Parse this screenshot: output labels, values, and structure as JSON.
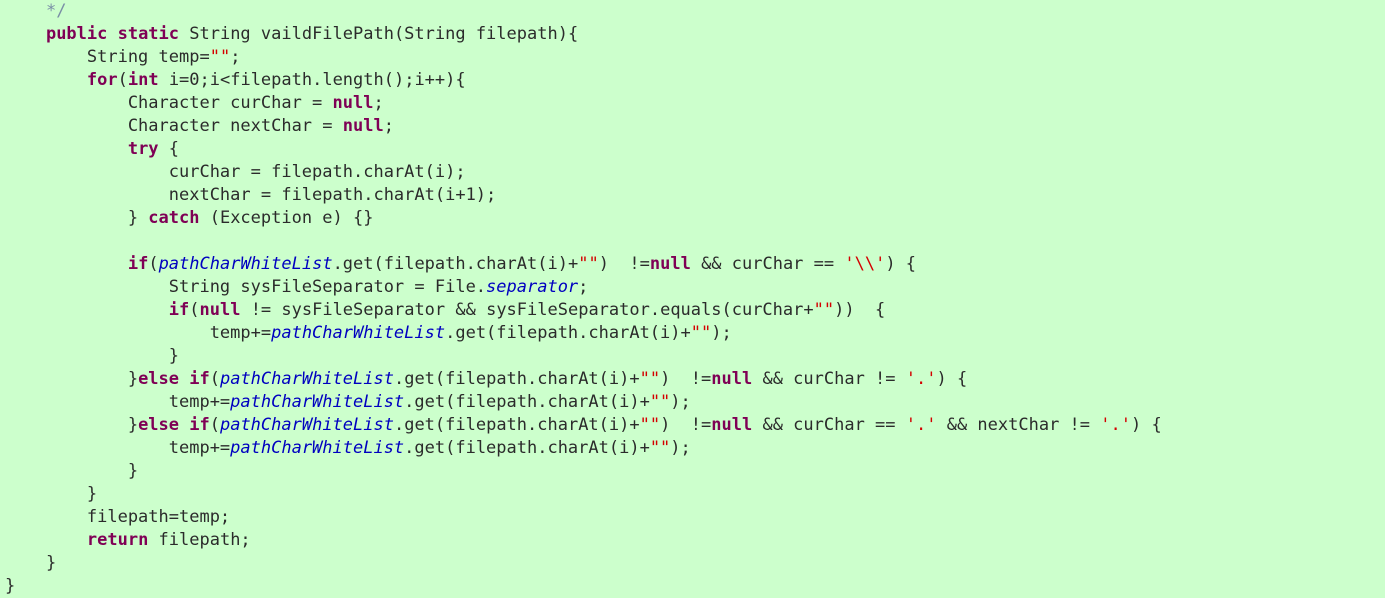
{
  "editor": {
    "background_color": "#ccffcc",
    "default_text_color": "#2b2b2b",
    "language": "java",
    "token_colors": {
      "keyword": "#7f0055",
      "string": "#d40000",
      "comment": "#7a8fa6",
      "field": "#0000c0",
      "plain": "#2b2b2b"
    }
  },
  "code": {
    "lines": [
      {
        "tokens": [
          {
            "t": "    ",
            "k": "plain"
          },
          {
            "t": "*/",
            "k": "comment"
          }
        ]
      },
      {
        "tokens": [
          {
            "t": "    ",
            "k": "plain"
          },
          {
            "t": "public static",
            "k": "keyword"
          },
          {
            "t": " String vaildFilePath(String filepath){",
            "k": "plain"
          }
        ]
      },
      {
        "tokens": [
          {
            "t": "        String temp=",
            "k": "plain"
          },
          {
            "t": "\"\"",
            "k": "string"
          },
          {
            "t": ";",
            "k": "plain"
          }
        ]
      },
      {
        "tokens": [
          {
            "t": "        ",
            "k": "plain"
          },
          {
            "t": "for",
            "k": "keyword"
          },
          {
            "t": "(",
            "k": "plain"
          },
          {
            "t": "int",
            "k": "keyword"
          },
          {
            "t": " i=0;i<filepath.length();i++){",
            "k": "plain"
          }
        ]
      },
      {
        "tokens": [
          {
            "t": "            Character curChar = ",
            "k": "plain"
          },
          {
            "t": "null",
            "k": "keyword"
          },
          {
            "t": ";",
            "k": "plain"
          }
        ]
      },
      {
        "tokens": [
          {
            "t": "            Character nextChar = ",
            "k": "plain"
          },
          {
            "t": "null",
            "k": "keyword"
          },
          {
            "t": ";",
            "k": "plain"
          }
        ]
      },
      {
        "tokens": [
          {
            "t": "            ",
            "k": "plain"
          },
          {
            "t": "try",
            "k": "keyword"
          },
          {
            "t": " {",
            "k": "plain"
          }
        ]
      },
      {
        "tokens": [
          {
            "t": "                curChar = filepath.charAt(i);",
            "k": "plain"
          }
        ]
      },
      {
        "tokens": [
          {
            "t": "                nextChar = filepath.charAt(i+1);",
            "k": "plain"
          }
        ]
      },
      {
        "tokens": [
          {
            "t": "            } ",
            "k": "plain"
          },
          {
            "t": "catch",
            "k": "keyword"
          },
          {
            "t": " (Exception e) {}",
            "k": "plain"
          }
        ]
      },
      {
        "tokens": []
      },
      {
        "tokens": [
          {
            "t": "            ",
            "k": "plain"
          },
          {
            "t": "if",
            "k": "keyword"
          },
          {
            "t": "(",
            "k": "plain"
          },
          {
            "t": "pathCharWhiteList",
            "k": "field"
          },
          {
            "t": ".get(filepath.charAt(i)+",
            "k": "plain"
          },
          {
            "t": "\"\"",
            "k": "string"
          },
          {
            "t": ")  !=",
            "k": "plain"
          },
          {
            "t": "null",
            "k": "keyword"
          },
          {
            "t": " && curChar == ",
            "k": "plain"
          },
          {
            "t": "'\\\\'",
            "k": "string"
          },
          {
            "t": ") {",
            "k": "plain"
          }
        ]
      },
      {
        "tokens": [
          {
            "t": "                String sysFileSeparator = File.",
            "k": "plain"
          },
          {
            "t": "separator",
            "k": "static"
          },
          {
            "t": ";",
            "k": "plain"
          }
        ]
      },
      {
        "tokens": [
          {
            "t": "                ",
            "k": "plain"
          },
          {
            "t": "if",
            "k": "keyword"
          },
          {
            "t": "(",
            "k": "plain"
          },
          {
            "t": "null",
            "k": "keyword"
          },
          {
            "t": " != sysFileSeparator && sysFileSeparator.equals(curChar+",
            "k": "plain"
          },
          {
            "t": "\"\"",
            "k": "string"
          },
          {
            "t": "))  {",
            "k": "plain"
          }
        ]
      },
      {
        "tokens": [
          {
            "t": "                    temp+=",
            "k": "plain"
          },
          {
            "t": "pathCharWhiteList",
            "k": "field"
          },
          {
            "t": ".get(filepath.charAt(i)+",
            "k": "plain"
          },
          {
            "t": "\"\"",
            "k": "string"
          },
          {
            "t": ");",
            "k": "plain"
          }
        ]
      },
      {
        "tokens": [
          {
            "t": "                }",
            "k": "plain"
          }
        ]
      },
      {
        "tokens": [
          {
            "t": "            }",
            "k": "plain"
          },
          {
            "t": "else if",
            "k": "keyword"
          },
          {
            "t": "(",
            "k": "plain"
          },
          {
            "t": "pathCharWhiteList",
            "k": "field"
          },
          {
            "t": ".get(filepath.charAt(i)+",
            "k": "plain"
          },
          {
            "t": "\"\"",
            "k": "string"
          },
          {
            "t": ")  !=",
            "k": "plain"
          },
          {
            "t": "null",
            "k": "keyword"
          },
          {
            "t": " && curChar != ",
            "k": "plain"
          },
          {
            "t": "'.'",
            "k": "string"
          },
          {
            "t": ") {",
            "k": "plain"
          }
        ]
      },
      {
        "tokens": [
          {
            "t": "                temp+=",
            "k": "plain"
          },
          {
            "t": "pathCharWhiteList",
            "k": "field"
          },
          {
            "t": ".get(filepath.charAt(i)+",
            "k": "plain"
          },
          {
            "t": "\"\"",
            "k": "string"
          },
          {
            "t": ");",
            "k": "plain"
          }
        ]
      },
      {
        "tokens": [
          {
            "t": "            }",
            "k": "plain"
          },
          {
            "t": "else if",
            "k": "keyword"
          },
          {
            "t": "(",
            "k": "plain"
          },
          {
            "t": "pathCharWhiteList",
            "k": "field"
          },
          {
            "t": ".get(filepath.charAt(i)+",
            "k": "plain"
          },
          {
            "t": "\"\"",
            "k": "string"
          },
          {
            "t": ")  !=",
            "k": "plain"
          },
          {
            "t": "null",
            "k": "keyword"
          },
          {
            "t": " && curChar == ",
            "k": "plain"
          },
          {
            "t": "'.'",
            "k": "string"
          },
          {
            "t": " && nextChar != ",
            "k": "plain"
          },
          {
            "t": "'.'",
            "k": "string"
          },
          {
            "t": ") {",
            "k": "plain"
          }
        ]
      },
      {
        "tokens": [
          {
            "t": "                temp+=",
            "k": "plain"
          },
          {
            "t": "pathCharWhiteList",
            "k": "field"
          },
          {
            "t": ".get(filepath.charAt(i)+",
            "k": "plain"
          },
          {
            "t": "\"\"",
            "k": "string"
          },
          {
            "t": ");",
            "k": "plain"
          }
        ]
      },
      {
        "tokens": [
          {
            "t": "            }",
            "k": "plain"
          }
        ]
      },
      {
        "tokens": [
          {
            "t": "        }",
            "k": "plain"
          }
        ]
      },
      {
        "tokens": [
          {
            "t": "        filepath=temp;",
            "k": "plain"
          }
        ]
      },
      {
        "tokens": [
          {
            "t": "        ",
            "k": "plain"
          },
          {
            "t": "return",
            "k": "keyword"
          },
          {
            "t": " filepath;",
            "k": "plain"
          }
        ]
      },
      {
        "tokens": [
          {
            "t": "    }",
            "k": "plain"
          }
        ]
      },
      {
        "tokens": [
          {
            "t": "}",
            "k": "plain"
          }
        ]
      }
    ]
  }
}
